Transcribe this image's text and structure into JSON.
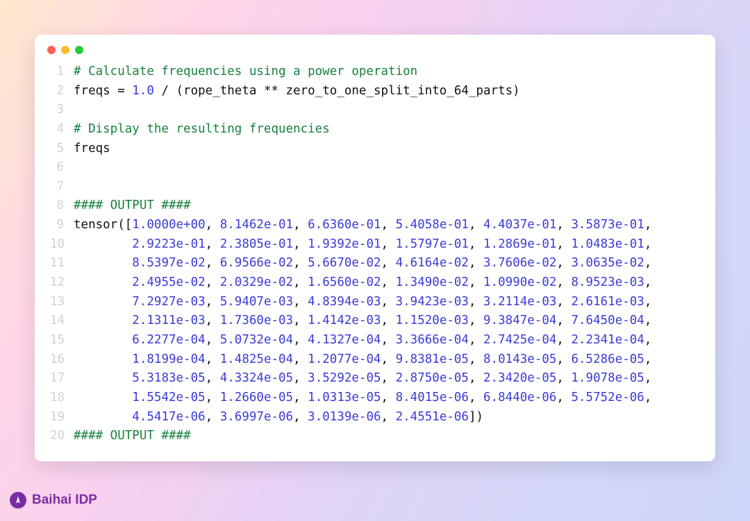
{
  "brand": "Baihai IDP",
  "lines": [
    {
      "n": "1",
      "segs": [
        {
          "t": "# Calculate frequencies using a power operation",
          "c": "cm"
        }
      ]
    },
    {
      "n": "2",
      "segs": [
        {
          "t": "freqs = ",
          "c": "kw"
        },
        {
          "t": "1.0",
          "c": "num"
        },
        {
          "t": " / (rope_theta ** zero_to_one_split_into_64_parts)",
          "c": "kw"
        }
      ]
    },
    {
      "n": "3",
      "segs": [
        {
          "t": "",
          "c": "kw"
        }
      ]
    },
    {
      "n": "4",
      "segs": [
        {
          "t": "# Display the resulting frequencies",
          "c": "cm"
        }
      ]
    },
    {
      "n": "5",
      "segs": [
        {
          "t": "freqs",
          "c": "kw"
        }
      ]
    },
    {
      "n": "6",
      "segs": [
        {
          "t": "",
          "c": "kw"
        }
      ]
    },
    {
      "n": "7",
      "segs": [
        {
          "t": "",
          "c": "kw"
        }
      ]
    },
    {
      "n": "8",
      "segs": [
        {
          "t": "#### OUTPUT ####",
          "c": "cm"
        }
      ]
    },
    {
      "n": "9",
      "segs": [
        {
          "t": "tensor([",
          "c": "kw"
        },
        {
          "t": "1.0000e+00",
          "c": "num"
        },
        {
          "t": ", ",
          "c": "kw"
        },
        {
          "t": "8.1462e-01",
          "c": "num"
        },
        {
          "t": ", ",
          "c": "kw"
        },
        {
          "t": "6.6360e-01",
          "c": "num"
        },
        {
          "t": ", ",
          "c": "kw"
        },
        {
          "t": "5.4058e-01",
          "c": "num"
        },
        {
          "t": ", ",
          "c": "kw"
        },
        {
          "t": "4.4037e-01",
          "c": "num"
        },
        {
          "t": ", ",
          "c": "kw"
        },
        {
          "t": "3.5873e-01",
          "c": "num"
        },
        {
          "t": ",",
          "c": "kw"
        }
      ]
    },
    {
      "n": "10",
      "segs": [
        {
          "t": "        ",
          "c": "kw"
        },
        {
          "t": "2.9223e-01",
          "c": "num"
        },
        {
          "t": ", ",
          "c": "kw"
        },
        {
          "t": "2.3805e-01",
          "c": "num"
        },
        {
          "t": ", ",
          "c": "kw"
        },
        {
          "t": "1.9392e-01",
          "c": "num"
        },
        {
          "t": ", ",
          "c": "kw"
        },
        {
          "t": "1.5797e-01",
          "c": "num"
        },
        {
          "t": ", ",
          "c": "kw"
        },
        {
          "t": "1.2869e-01",
          "c": "num"
        },
        {
          "t": ", ",
          "c": "kw"
        },
        {
          "t": "1.0483e-01",
          "c": "num"
        },
        {
          "t": ",",
          "c": "kw"
        }
      ]
    },
    {
      "n": "11",
      "segs": [
        {
          "t": "        ",
          "c": "kw"
        },
        {
          "t": "8.5397e-02",
          "c": "num"
        },
        {
          "t": ", ",
          "c": "kw"
        },
        {
          "t": "6.9566e-02",
          "c": "num"
        },
        {
          "t": ", ",
          "c": "kw"
        },
        {
          "t": "5.6670e-02",
          "c": "num"
        },
        {
          "t": ", ",
          "c": "kw"
        },
        {
          "t": "4.6164e-02",
          "c": "num"
        },
        {
          "t": ", ",
          "c": "kw"
        },
        {
          "t": "3.7606e-02",
          "c": "num"
        },
        {
          "t": ", ",
          "c": "kw"
        },
        {
          "t": "3.0635e-02",
          "c": "num"
        },
        {
          "t": ",",
          "c": "kw"
        }
      ]
    },
    {
      "n": "12",
      "segs": [
        {
          "t": "        ",
          "c": "kw"
        },
        {
          "t": "2.4955e-02",
          "c": "num"
        },
        {
          "t": ", ",
          "c": "kw"
        },
        {
          "t": "2.0329e-02",
          "c": "num"
        },
        {
          "t": ", ",
          "c": "kw"
        },
        {
          "t": "1.6560e-02",
          "c": "num"
        },
        {
          "t": ", ",
          "c": "kw"
        },
        {
          "t": "1.3490e-02",
          "c": "num"
        },
        {
          "t": ", ",
          "c": "kw"
        },
        {
          "t": "1.0990e-02",
          "c": "num"
        },
        {
          "t": ", ",
          "c": "kw"
        },
        {
          "t": "8.9523e-03",
          "c": "num"
        },
        {
          "t": ",",
          "c": "kw"
        }
      ]
    },
    {
      "n": "13",
      "segs": [
        {
          "t": "        ",
          "c": "kw"
        },
        {
          "t": "7.2927e-03",
          "c": "num"
        },
        {
          "t": ", ",
          "c": "kw"
        },
        {
          "t": "5.9407e-03",
          "c": "num"
        },
        {
          "t": ", ",
          "c": "kw"
        },
        {
          "t": "4.8394e-03",
          "c": "num"
        },
        {
          "t": ", ",
          "c": "kw"
        },
        {
          "t": "3.9423e-03",
          "c": "num"
        },
        {
          "t": ", ",
          "c": "kw"
        },
        {
          "t": "3.2114e-03",
          "c": "num"
        },
        {
          "t": ", ",
          "c": "kw"
        },
        {
          "t": "2.6161e-03",
          "c": "num"
        },
        {
          "t": ",",
          "c": "kw"
        }
      ]
    },
    {
      "n": "14",
      "segs": [
        {
          "t": "        ",
          "c": "kw"
        },
        {
          "t": "2.1311e-03",
          "c": "num"
        },
        {
          "t": ", ",
          "c": "kw"
        },
        {
          "t": "1.7360e-03",
          "c": "num"
        },
        {
          "t": ", ",
          "c": "kw"
        },
        {
          "t": "1.4142e-03",
          "c": "num"
        },
        {
          "t": ", ",
          "c": "kw"
        },
        {
          "t": "1.1520e-03",
          "c": "num"
        },
        {
          "t": ", ",
          "c": "kw"
        },
        {
          "t": "9.3847e-04",
          "c": "num"
        },
        {
          "t": ", ",
          "c": "kw"
        },
        {
          "t": "7.6450e-04",
          "c": "num"
        },
        {
          "t": ",",
          "c": "kw"
        }
      ]
    },
    {
      "n": "15",
      "segs": [
        {
          "t": "        ",
          "c": "kw"
        },
        {
          "t": "6.2277e-04",
          "c": "num"
        },
        {
          "t": ", ",
          "c": "kw"
        },
        {
          "t": "5.0732e-04",
          "c": "num"
        },
        {
          "t": ", ",
          "c": "kw"
        },
        {
          "t": "4.1327e-04",
          "c": "num"
        },
        {
          "t": ", ",
          "c": "kw"
        },
        {
          "t": "3.3666e-04",
          "c": "num"
        },
        {
          "t": ", ",
          "c": "kw"
        },
        {
          "t": "2.7425e-04",
          "c": "num"
        },
        {
          "t": ", ",
          "c": "kw"
        },
        {
          "t": "2.2341e-04",
          "c": "num"
        },
        {
          "t": ",",
          "c": "kw"
        }
      ]
    },
    {
      "n": "16",
      "segs": [
        {
          "t": "        ",
          "c": "kw"
        },
        {
          "t": "1.8199e-04",
          "c": "num"
        },
        {
          "t": ", ",
          "c": "kw"
        },
        {
          "t": "1.4825e-04",
          "c": "num"
        },
        {
          "t": ", ",
          "c": "kw"
        },
        {
          "t": "1.2077e-04",
          "c": "num"
        },
        {
          "t": ", ",
          "c": "kw"
        },
        {
          "t": "9.8381e-05",
          "c": "num"
        },
        {
          "t": ", ",
          "c": "kw"
        },
        {
          "t": "8.0143e-05",
          "c": "num"
        },
        {
          "t": ", ",
          "c": "kw"
        },
        {
          "t": "6.5286e-05",
          "c": "num"
        },
        {
          "t": ",",
          "c": "kw"
        }
      ]
    },
    {
      "n": "17",
      "segs": [
        {
          "t": "        ",
          "c": "kw"
        },
        {
          "t": "5.3183e-05",
          "c": "num"
        },
        {
          "t": ", ",
          "c": "kw"
        },
        {
          "t": "4.3324e-05",
          "c": "num"
        },
        {
          "t": ", ",
          "c": "kw"
        },
        {
          "t": "3.5292e-05",
          "c": "num"
        },
        {
          "t": ", ",
          "c": "kw"
        },
        {
          "t": "2.8750e-05",
          "c": "num"
        },
        {
          "t": ", ",
          "c": "kw"
        },
        {
          "t": "2.3420e-05",
          "c": "num"
        },
        {
          "t": ", ",
          "c": "kw"
        },
        {
          "t": "1.9078e-05",
          "c": "num"
        },
        {
          "t": ",",
          "c": "kw"
        }
      ]
    },
    {
      "n": "18",
      "segs": [
        {
          "t": "        ",
          "c": "kw"
        },
        {
          "t": "1.5542e-05",
          "c": "num"
        },
        {
          "t": ", ",
          "c": "kw"
        },
        {
          "t": "1.2660e-05",
          "c": "num"
        },
        {
          "t": ", ",
          "c": "kw"
        },
        {
          "t": "1.0313e-05",
          "c": "num"
        },
        {
          "t": ", ",
          "c": "kw"
        },
        {
          "t": "8.4015e-06",
          "c": "num"
        },
        {
          "t": ", ",
          "c": "kw"
        },
        {
          "t": "6.8440e-06",
          "c": "num"
        },
        {
          "t": ", ",
          "c": "kw"
        },
        {
          "t": "5.5752e-06",
          "c": "num"
        },
        {
          "t": ",",
          "c": "kw"
        }
      ]
    },
    {
      "n": "19",
      "segs": [
        {
          "t": "        ",
          "c": "kw"
        },
        {
          "t": "4.5417e-06",
          "c": "num"
        },
        {
          "t": ", ",
          "c": "kw"
        },
        {
          "t": "3.6997e-06",
          "c": "num"
        },
        {
          "t": ", ",
          "c": "kw"
        },
        {
          "t": "3.0139e-06",
          "c": "num"
        },
        {
          "t": ", ",
          "c": "kw"
        },
        {
          "t": "2.4551e-06",
          "c": "num"
        },
        {
          "t": "])",
          "c": "kw"
        }
      ]
    },
    {
      "n": "20",
      "segs": [
        {
          "t": "#### OUTPUT ####",
          "c": "cm"
        }
      ]
    }
  ]
}
